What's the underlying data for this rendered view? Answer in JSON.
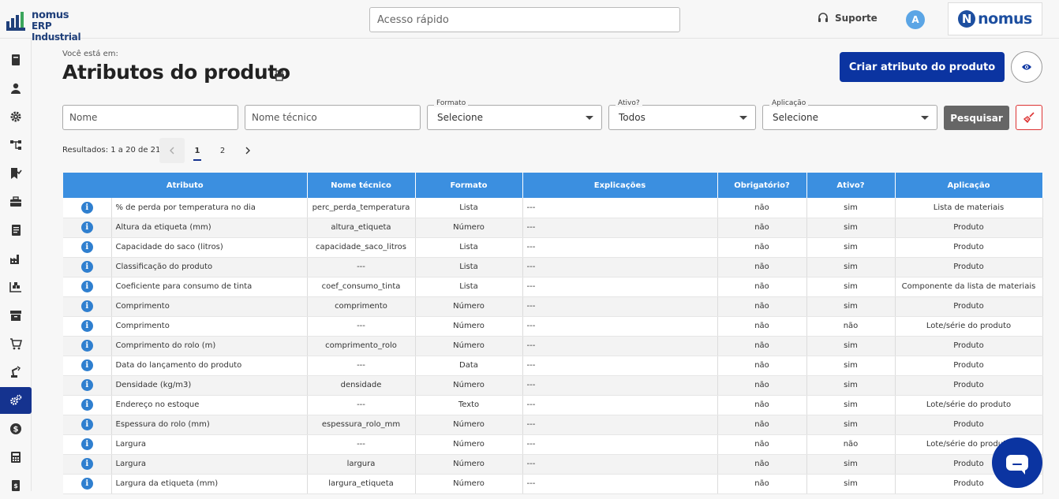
{
  "header": {
    "logo_line1": "nomus",
    "logo_line2": "ERP Industrial",
    "search_placeholder": "Acesso rápido",
    "support_label": "Suporte",
    "avatar_letter": "A",
    "brand_letter": "N",
    "brand_word": "nomus"
  },
  "sidebar": {
    "items": [
      "book-icon",
      "user-icon",
      "gear-icon",
      "hierarchy-icon",
      "flag-check-icon",
      "toolbox-icon",
      "document-icon",
      "factory-icon",
      "warehouse-icon",
      "archive-icon",
      "cart-icon",
      "robot-arm-icon",
      "gears-icon",
      "dollar-icon",
      "calculator-icon",
      "invoice-icon"
    ],
    "active_index": 12
  },
  "page": {
    "breadcrumb": "Você está em:",
    "title": "Atributos do produto",
    "create_button": "Criar atributo do produto"
  },
  "filters": {
    "nome_placeholder": "Nome",
    "nome_tecnico_placeholder": "Nome técnico",
    "formato_label": "Formato",
    "formato_value": "Selecione",
    "ativo_label": "Ativo?",
    "ativo_value": "Todos",
    "aplicacao_label": "Aplicação",
    "aplicacao_value": "Selecione",
    "search_button": "Pesquisar"
  },
  "pagination": {
    "results_text": "Resultados: 1 a 20 de 21.",
    "pages": [
      "1",
      "2"
    ],
    "current": "1"
  },
  "table": {
    "columns": [
      "Atributo",
      "Nome técnico",
      "Formato",
      "Explicações",
      "Obrigatório?",
      "Ativo?",
      "Aplicação"
    ],
    "rows": [
      [
        "% de perda por temperatura no dia",
        "perc_perda_temperatura",
        "Lista",
        "---",
        "não",
        "sim",
        "Lista de materiais"
      ],
      [
        "Altura da etiqueta (mm)",
        "altura_etiqueta",
        "Número",
        "---",
        "não",
        "sim",
        "Produto"
      ],
      [
        "Capacidade do saco (litros)",
        "capacidade_saco_litros",
        "Lista",
        "---",
        "não",
        "sim",
        "Produto"
      ],
      [
        "Classificação do produto",
        "---",
        "Lista",
        "---",
        "não",
        "sim",
        "Produto"
      ],
      [
        "Coeficiente para consumo de tinta",
        "coef_consumo_tinta",
        "Lista",
        "---",
        "não",
        "sim",
        "Componente da lista de materiais"
      ],
      [
        "Comprimento",
        "comprimento",
        "Número",
        "---",
        "não",
        "sim",
        "Produto"
      ],
      [
        "Comprimento",
        "---",
        "Número",
        "---",
        "não",
        "não",
        "Lote/série do produto"
      ],
      [
        "Comprimento do rolo (m)",
        "comprimento_rolo",
        "Número",
        "---",
        "não",
        "sim",
        "Produto"
      ],
      [
        "Data do lançamento do produto",
        "---",
        "Data",
        "---",
        "não",
        "sim",
        "Produto"
      ],
      [
        "Densidade (kg/m3)",
        "densidade",
        "Número",
        "---",
        "não",
        "sim",
        "Produto"
      ],
      [
        "Endereço no estoque",
        "---",
        "Texto",
        "---",
        "não",
        "sim",
        "Lote/série do produto"
      ],
      [
        "Espessura do rolo (mm)",
        "espessura_rolo_mm",
        "Número",
        "---",
        "não",
        "sim",
        "Produto"
      ],
      [
        "Largura",
        "---",
        "Número",
        "---",
        "não",
        "não",
        "Lote/série do produto"
      ],
      [
        "Largura",
        "largura",
        "Número",
        "---",
        "não",
        "sim",
        "Produto"
      ],
      [
        "Largura da etiqueta (mm)",
        "largura_etiqueta",
        "Número",
        "---",
        "não",
        "sim",
        "Produto"
      ]
    ]
  },
  "colors": {
    "primary": "#0b34a1",
    "table_header": "#3b8fe0",
    "info_icon": "#2f7fcf"
  }
}
